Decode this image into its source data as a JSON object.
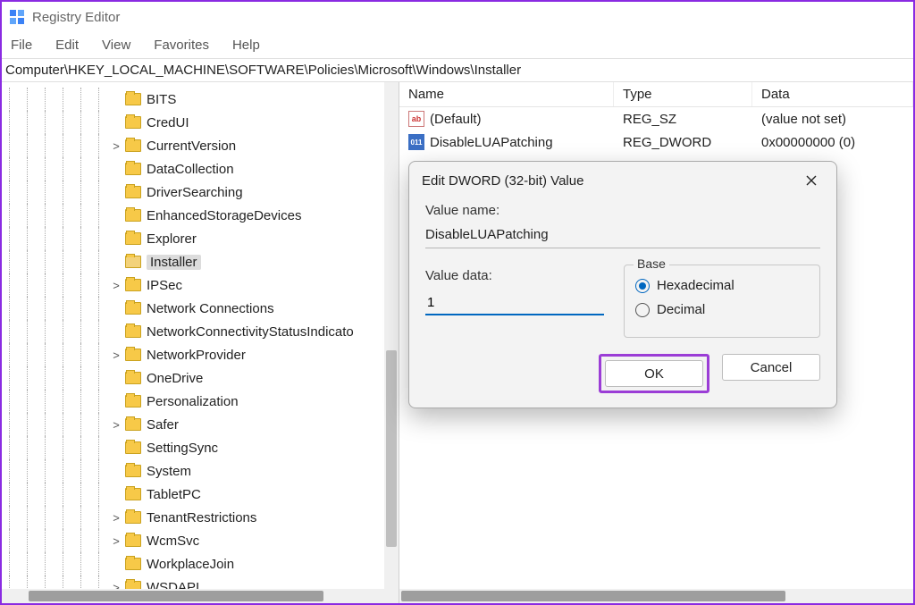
{
  "app": {
    "title": "Registry Editor"
  },
  "menu": {
    "file": "File",
    "edit": "Edit",
    "view": "View",
    "favorites": "Favorites",
    "help": "Help"
  },
  "address": "Computer\\HKEY_LOCAL_MACHINE\\SOFTWARE\\Policies\\Microsoft\\Windows\\Installer",
  "tree": [
    {
      "label": "BITS",
      "exp": ""
    },
    {
      "label": "CredUI",
      "exp": ""
    },
    {
      "label": "CurrentVersion",
      "exp": ">"
    },
    {
      "label": "DataCollection",
      "exp": ""
    },
    {
      "label": "DriverSearching",
      "exp": ""
    },
    {
      "label": "EnhancedStorageDevices",
      "exp": ""
    },
    {
      "label": "Explorer",
      "exp": ""
    },
    {
      "label": "Installer",
      "exp": "",
      "selected": true,
      "open": true
    },
    {
      "label": "IPSec",
      "exp": ">"
    },
    {
      "label": "Network Connections",
      "exp": ""
    },
    {
      "label": "NetworkConnectivityStatusIndicato",
      "exp": ""
    },
    {
      "label": "NetworkProvider",
      "exp": ">"
    },
    {
      "label": "OneDrive",
      "exp": ""
    },
    {
      "label": "Personalization",
      "exp": ""
    },
    {
      "label": "Safer",
      "exp": ">"
    },
    {
      "label": "SettingSync",
      "exp": ""
    },
    {
      "label": "System",
      "exp": ""
    },
    {
      "label": "TabletPC",
      "exp": ""
    },
    {
      "label": "TenantRestrictions",
      "exp": ">"
    },
    {
      "label": "WcmSvc",
      "exp": ">"
    },
    {
      "label": "WorkplaceJoin",
      "exp": ""
    },
    {
      "label": "WSDAPI",
      "exp": ">"
    }
  ],
  "list": {
    "headers": {
      "name": "Name",
      "type": "Type",
      "data": "Data"
    },
    "rows": [
      {
        "icon": "sz",
        "name": "(Default)",
        "type": "REG_SZ",
        "data": "(value not set)"
      },
      {
        "icon": "dw",
        "name": "DisableLUAPatching",
        "type": "REG_DWORD",
        "data": "0x00000000 (0)"
      }
    ]
  },
  "dialog": {
    "title": "Edit DWORD (32-bit) Value",
    "value_name_label": "Value name:",
    "value_name": "DisableLUAPatching",
    "value_data_label": "Value data:",
    "value_data": "1",
    "base_label": "Base",
    "hex": "Hexadecimal",
    "dec": "Decimal",
    "ok": "OK",
    "cancel": "Cancel"
  }
}
